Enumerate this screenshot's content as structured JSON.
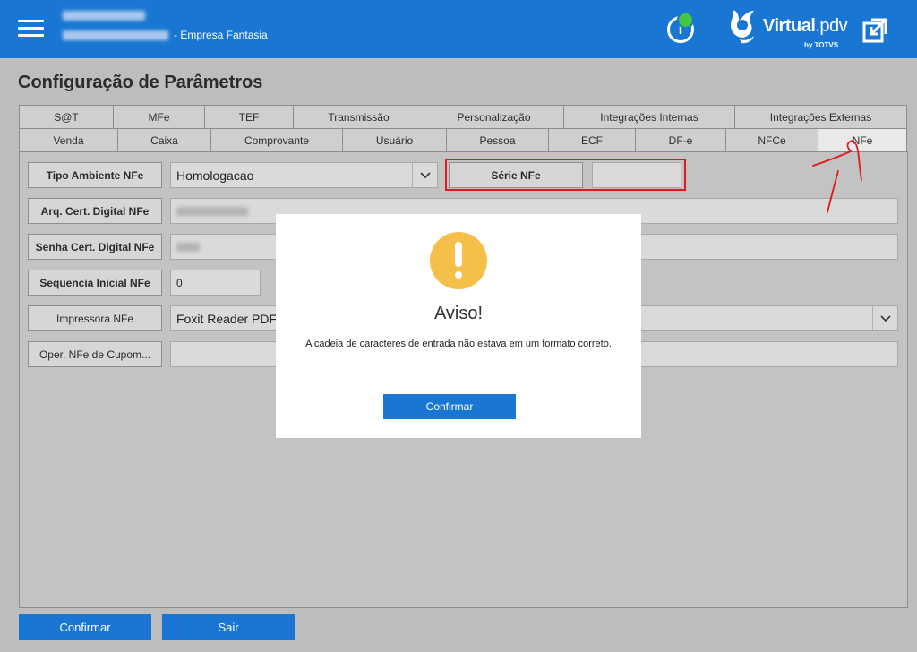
{
  "header": {
    "company": "- Empresa Fantasia",
    "info_symbol": "i",
    "logo_brand": "Virtual",
    "logo_suffix": ".pdv",
    "logo_sub": "by TOTVS",
    "background": "#1976d2",
    "status_color": "#43c743"
  },
  "page": {
    "title": "Configuração de Parâmetros"
  },
  "tabs_row1": [
    "S@T",
    "MFe",
    "TEF",
    "Transmissão",
    "Personalização",
    "Integrações Internas",
    "Integrações Externas"
  ],
  "tabs_row2": [
    "Venda",
    "Caixa",
    "Comprovante",
    "Usuário",
    "Pessoa",
    "ECF",
    "DF-e",
    "NFCe",
    "NFe"
  ],
  "active_tab": "NFe",
  "form": {
    "tipo_ambiente": {
      "label": "Tipo Ambiente NFe",
      "value": "Homologacao"
    },
    "serie": {
      "label": "Série NFe",
      "value": ""
    },
    "arq_cert": {
      "label": "Arq. Cert. Digital NFe"
    },
    "senha_cert": {
      "label": "Senha Cert. Digital NFe"
    },
    "sequencia": {
      "label": "Sequencia Inicial NFe",
      "value": "0"
    },
    "impressora": {
      "label": "Impressora NFe",
      "value": "Foxit Reader PDF"
    },
    "oper": {
      "label": "Oper. NFe de Cupom...",
      "value": ""
    }
  },
  "footer": {
    "confirm_label": "Confirmar",
    "exit_label": "Sair"
  },
  "modal": {
    "title": "Aviso!",
    "message": "A cadeia de caracteres de entrada não estava em um formato correto.",
    "confirm_label": "Confirmar",
    "icon": "warning-icon",
    "icon_color": "#f5c04a"
  },
  "colors": {
    "primary": "#1976d2",
    "highlight": "#e0191c"
  }
}
